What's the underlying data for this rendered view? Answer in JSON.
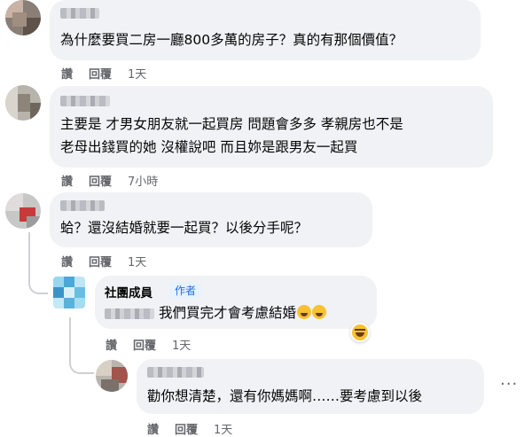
{
  "comments": [
    {
      "text": "為什麼要買二房一廳800多萬的房子？真的有那個價值？",
      "actions": {
        "like": "讚",
        "reply": "回覆",
        "time": "1天"
      }
    },
    {
      "text_line1": "主要是 才男女朋友就一起買房 問題會多多 孝親房也不是",
      "text_line2": "老母出錢買的她 沒權說吧 而且妳是跟男友一起買",
      "actions": {
        "like": "讚",
        "reply": "回覆",
        "time": "7小時"
      }
    },
    {
      "text": "蛤？還沒結婚就要一起買？以後分手呢？",
      "actions": {
        "like": "讚",
        "reply": "回覆",
        "time": "1天"
      }
    }
  ],
  "replies": [
    {
      "author": "社團成員",
      "badge": "作者",
      "text": "我們買完才會考慮結婚",
      "emoji": "rolling-on-floor-laughing",
      "reaction": "haha",
      "actions": {
        "like": "讚",
        "reply": "回覆",
        "time": "1天"
      }
    },
    {
      "text": "勸你想清楚，還有你媽媽啊……要考慮到以後",
      "actions": {
        "like": "讚",
        "reply": "回覆",
        "time": "1天"
      }
    }
  ],
  "more_options": "···"
}
